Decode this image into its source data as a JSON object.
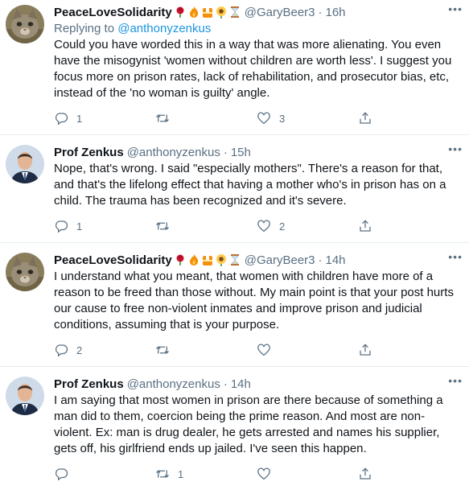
{
  "tweets": [
    {
      "author_name": "PeaceLoveSolidarity",
      "author_emojis": [
        "rose-emoji",
        "fire-emoji",
        "construction-vest-emoji",
        "sunflower-emoji",
        "hourglass-emoji"
      ],
      "handle": "@GaryBeer3",
      "separator": "·",
      "time": "16h",
      "replying_prefix": "Replying to",
      "replying_to": "@anthonyzenkus",
      "text": "Could you have worded this in a way that was more alienating.  You even have the misogynist 'women without children are worth less'.  I suggest you focus more on prison rates, lack of rehabilitation, and prosecutor bias, etc, instead of the 'no woman is guilty' angle.",
      "reply_count": "1",
      "retweet_count": "",
      "like_count": "3"
    },
    {
      "author_name": "Prof Zenkus",
      "handle": "@anthonyzenkus",
      "separator": "·",
      "time": "15h",
      "text": "Nope, that's wrong. I said \"especially mothers\". There's a reason for that, and that's the lifelong effect that having a mother who's in prison has on a child. The trauma has been recognized and it's severe.",
      "reply_count": "1",
      "retweet_count": "",
      "like_count": "2"
    },
    {
      "author_name": "PeaceLoveSolidarity",
      "author_emojis": [
        "rose-emoji",
        "fire-emoji",
        "construction-vest-emoji",
        "sunflower-emoji",
        "hourglass-emoji"
      ],
      "handle": "@GaryBeer3",
      "separator": "·",
      "time": "14h",
      "text": "I understand what you meant, that women with children have more of a reason to be freed than those without.  My main point is that your post hurts our cause to free non-violent inmates and improve prison and judicial conditions, assuming that is your purpose.",
      "reply_count": "2",
      "retweet_count": "",
      "like_count": ""
    },
    {
      "author_name": "Prof Zenkus",
      "handle": "@anthonyzenkus",
      "separator": "·",
      "time": "14h",
      "text": "I am saying that most women in prison are there because of something a man did to them, coercion being the prime reason. And most are non-violent. Ex: man is drug dealer, he gets arrested and names his supplier, gets off, his girlfriend ends up jailed. I've seen this happen.",
      "reply_count": "",
      "retweet_count": "1",
      "like_count": ""
    }
  ],
  "more_icon": "ellipsis-icon",
  "colors": {
    "link": "#1b95e0",
    "secondary": "#5b7083",
    "divider": "#e6ecf0"
  }
}
